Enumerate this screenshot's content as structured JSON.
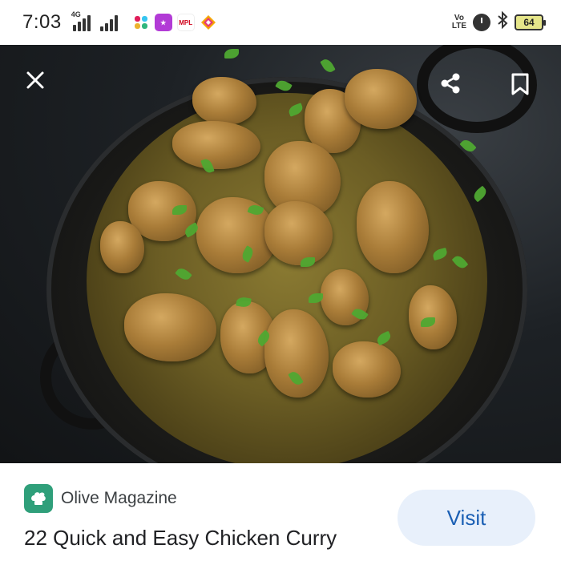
{
  "status_bar": {
    "time": "7:03",
    "network_tag": "4G",
    "volte_line1": "Vo",
    "volte_line2": "LTE",
    "battery": "64",
    "mpl_label": "MPL"
  },
  "hero": {
    "close_icon": "close-icon",
    "share_icon": "share-icon",
    "bookmark_icon": "bookmark-icon"
  },
  "card": {
    "source_name": "Olive Magazine",
    "visit_label": "Visit",
    "title": "22 Quick and Easy Chicken Curry"
  },
  "colors": {
    "accent": "#1a5fb4",
    "visit_bg": "#e8f0fb",
    "source_logo": "#2f9f7a"
  }
}
